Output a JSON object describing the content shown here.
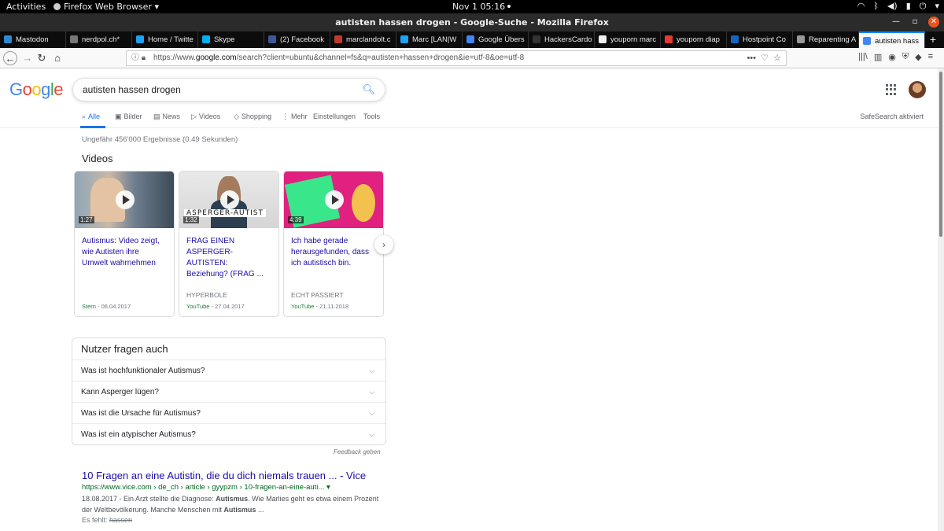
{
  "os": {
    "activities": "Activities",
    "app_name": "Firefox Web Browser",
    "clock": "Nov 1  05:16"
  },
  "window": {
    "title": "autisten hassen drogen - Google-Suche - Mozilla Firefox"
  },
  "tabs": [
    {
      "label": "Mastodon",
      "color": "#3088d4"
    },
    {
      "label": "nerdpol.ch*",
      "color": "#777777"
    },
    {
      "label": "Home / Twitte",
      "color": "#1da1f2"
    },
    {
      "label": "Skype",
      "color": "#00aff0"
    },
    {
      "label": "(2) Facebook",
      "color": "#3b5998"
    },
    {
      "label": "marclandolt.c",
      "color": "#c0392b"
    },
    {
      "label": "Marc [LAN|W",
      "color": "#1da1f2"
    },
    {
      "label": "Google Übers",
      "color": "#4285f4"
    },
    {
      "label": "HackersCardo",
      "color": "#333333"
    },
    {
      "label": "youporn marc",
      "color": "#eeeeee"
    },
    {
      "label": "youporn diap",
      "color": "#e53935"
    },
    {
      "label": "Hostpoint Co",
      "color": "#1565c0"
    },
    {
      "label": "Reparenting A",
      "color": "#999999"
    },
    {
      "label": "autisten hass",
      "color": "#4285f4",
      "active": true
    }
  ],
  "navbar": {
    "url_prefix": "https://www.",
    "url_host": "google.com",
    "url_rest": "/search?client=ubuntu&channel=fs&q=autisten+hassen+drogen&ie=utf-8&oe=utf-8"
  },
  "google": {
    "query": "autisten hassen drogen",
    "tabs": [
      "Alle",
      "Bilder",
      "News",
      "Videos",
      "Shopping",
      "Mehr",
      "Einstellungen",
      "Tools"
    ],
    "safesearch": "SafeSearch aktiviert",
    "stats": "Ungefähr 456'000 Ergebnisse (0.49 Sekunden)",
    "videos_heading": "Videos",
    "videos": [
      {
        "title": "Autismus: Video zeigt, wie Autisten ihre Umwelt wahrnehmen",
        "duration": "1:27",
        "source": "",
        "site": "Stern",
        "date": " - 06.04.2017",
        "caption": ""
      },
      {
        "title": "FRAG EINEN ASPERGER-AUTISTEN: Beziehung? (FRAG ...",
        "duration": "1:32",
        "source": "HYPERBOLE",
        "site": "YouTube",
        "date": " - 27.04.2017",
        "caption": "ASPERGER-AUTIST"
      },
      {
        "title": "Ich habe gerade herausgefunden, dass ich autistisch bin.",
        "duration": "4:39",
        "source": "ECHT PASSIERT",
        "site": "YouTube",
        "date": " - 21.11.2018",
        "caption": ""
      }
    ],
    "paa_heading": "Nutzer fragen auch",
    "paa": [
      "Was ist hochfunktionaler Autismus?",
      "Kann Asperger lügen?",
      "Was ist die Ursache für Autismus?",
      "Was ist ein atypischer Autismus?"
    ],
    "feedback": "Feedback geben",
    "result": {
      "title": "10 Fragen an eine Autistin, die du dich niemals trauen ... - Vice",
      "url": "https://www.vice.com › de_ch › article › gyypzm › 10-fragen-an-eine-auti... ▾",
      "date": "18.08.2017 - ",
      "snippet_1": "Ein Arzt stellte die Diagnose: ",
      "bold_1": "Autismus",
      "snippet_2": ". Wie Marlies geht es etwa einem Prozent der Weltbevölkerung. Manche Menschen mit ",
      "bold_2": "Autismus",
      "snippet_3": " ...",
      "missing_label": "Es fehlt: ",
      "missing_word": "hassen"
    }
  }
}
